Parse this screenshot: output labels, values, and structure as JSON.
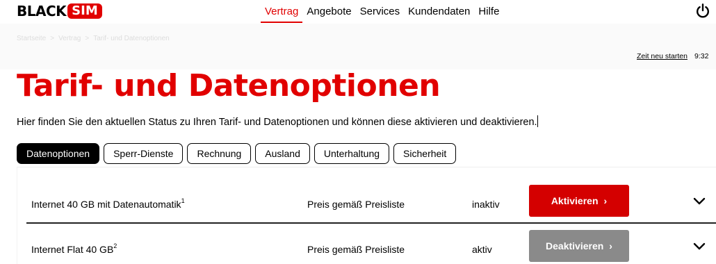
{
  "header": {
    "logo": {
      "black": "BLACK",
      "sim": "SIM"
    },
    "nav": [
      {
        "label": "Vertrag",
        "active": true
      },
      {
        "label": "Angebote",
        "active": false
      },
      {
        "label": "Services",
        "active": false
      },
      {
        "label": "Kundendaten",
        "active": false
      },
      {
        "label": "Hilfe",
        "active": false
      }
    ],
    "power_icon": "power-icon"
  },
  "breadcrumb": [
    "Startseite",
    "Vertrag",
    "Tarif- und Datenoptionen"
  ],
  "breadcrumb_separator": ">",
  "session": {
    "restart_label": "Zeit neu starten",
    "time": "9:32"
  },
  "page": {
    "title": "Tarif- und Datenoptionen",
    "intro": "Hier finden Sie den aktuellen Status zu Ihren Tarif- und Datenoptionen und können diese aktivieren und deaktivieren."
  },
  "tabs": [
    {
      "label": "Datenoptionen",
      "active": true
    },
    {
      "label": "Sperr-Dienste",
      "active": false
    },
    {
      "label": "Rechnung",
      "active": false
    },
    {
      "label": "Ausland",
      "active": false
    },
    {
      "label": "Unterhaltung",
      "active": false
    },
    {
      "label": "Sicherheit",
      "active": false
    }
  ],
  "options": [
    {
      "name": "Internet 40 GB mit Datenautomatik",
      "footnote": "1",
      "price": "Preis gemäß Preisliste",
      "status": "inaktiv",
      "action": "Aktivieren",
      "action_arrow": "›"
    },
    {
      "name": "Internet Flat 40 GB",
      "footnote": "2",
      "price": "Preis gemäß Preisliste",
      "status": "aktiv",
      "action": "Deaktivieren",
      "action_arrow": "›"
    }
  ],
  "colors": {
    "brand": "#e10000",
    "button_active": "#d40000",
    "button_disabled": "#8a8a8a"
  }
}
